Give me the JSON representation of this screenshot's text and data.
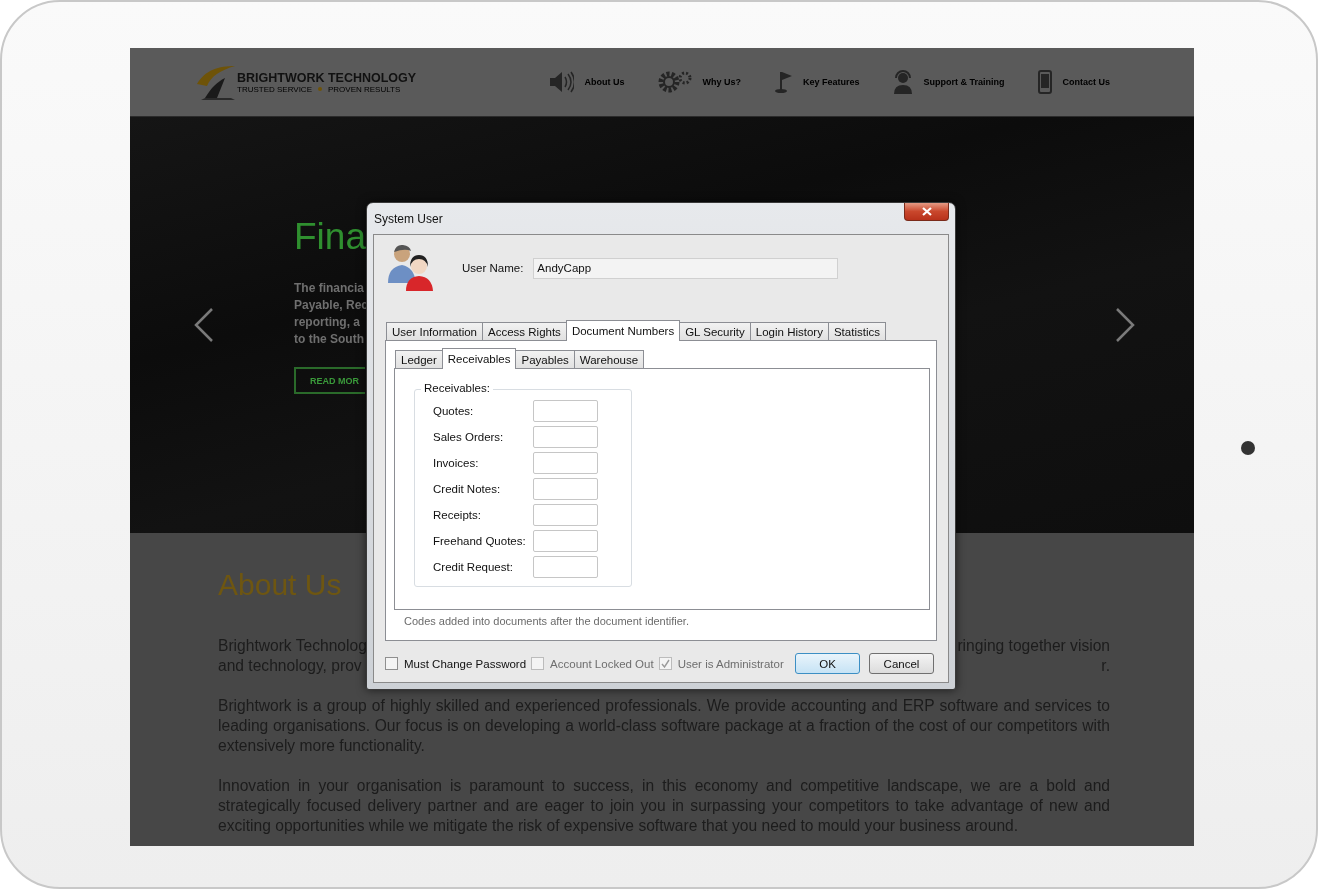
{
  "header": {
    "logo": {
      "name": "BRIGHTWORK TECHNOLOGY",
      "tagline_left": "TRUSTED SERVICE",
      "tagline_right": "PROVEN RESULTS"
    },
    "nav": [
      {
        "label": "About Us"
      },
      {
        "label": "Why Us?"
      },
      {
        "label": "Key Features"
      },
      {
        "label": "Support & Training"
      },
      {
        "label": "Contact Us"
      }
    ]
  },
  "hero": {
    "heading": "Fina",
    "lines": [
      "The financia",
      "Payable, Rec",
      "reporting, a",
      "to the South"
    ],
    "button": "READ MOR"
  },
  "about": {
    "heading": "About Us",
    "paragraph_1_lines": [
      {
        "left": "Brightwork Technolog",
        "right": "ringing together vision"
      },
      {
        "left": "and technology, prov",
        "right": "r."
      }
    ],
    "paragraphs": [
      "Brightwork is a group of highly skilled and experienced professionals. We provide accounting and ERP software and services to leading organisations. Our focus is on developing a world-class software package at a fraction of the cost of our competitors with extensively more functionality.",
      "Innovation in your organisation is paramount to success, in this economy and competitive landscape, we are a bold and strategically focused delivery partner and are eager to join you in surpassing your competitors to take advantage of new and exciting opportunities while we mitigate the risk of expensive software that you need to mould your business around."
    ]
  },
  "dialog": {
    "title": "System User",
    "user_name_label": "User Name:",
    "user_name_value": "AndyCapp",
    "tabs": [
      {
        "label": "User Information",
        "selected": false
      },
      {
        "label": "Access Rights",
        "selected": false
      },
      {
        "label": "Document Numbers",
        "selected": true
      },
      {
        "label": "GL Security",
        "selected": false
      },
      {
        "label": "Login History",
        "selected": false
      },
      {
        "label": "Statistics",
        "selected": false
      }
    ],
    "subtabs": [
      {
        "label": "Ledger",
        "selected": false
      },
      {
        "label": "Receivables",
        "selected": true
      },
      {
        "label": "Payables",
        "selected": false
      },
      {
        "label": "Warehouse",
        "selected": false
      }
    ],
    "group_title": "Receivables:",
    "fields": [
      "Quotes:",
      "Sales Orders:",
      "Invoices:",
      "Credit Notes:",
      "Receipts:",
      "Freehand Quotes:",
      "Credit Request:"
    ],
    "hint": "Codes added into documents after the document identifier.",
    "options": [
      {
        "label": "Must Change Password",
        "checked": false,
        "disabled": false
      },
      {
        "label": "Account Locked Out",
        "checked": false,
        "disabled": true
      },
      {
        "label": "User is Administrator",
        "checked": true,
        "disabled": true
      }
    ],
    "buttons": [
      {
        "label": "OK",
        "default": true
      },
      {
        "label": "Cancel",
        "default": false
      }
    ]
  }
}
